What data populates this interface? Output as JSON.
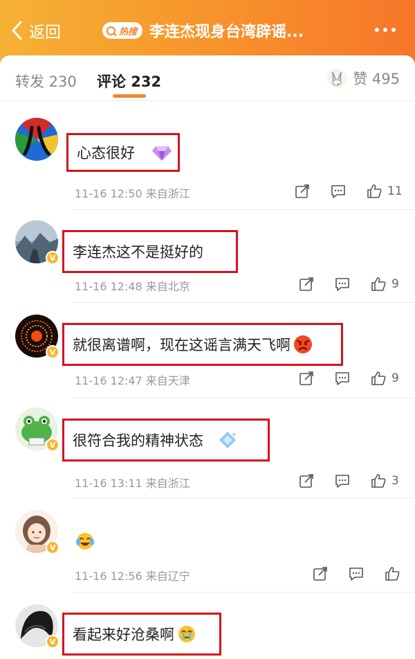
{
  "header": {
    "back_label": "返回",
    "hot_label": "热搜",
    "title": "李连杰现身台湾辟谣..."
  },
  "tabs": {
    "repost": "转发 230",
    "comment": "评论 232",
    "like_label": "赞 495"
  },
  "colors": {
    "accent": "#f7852a",
    "highlight_box": "#d4121c"
  },
  "comments": [
    {
      "avatar_icon": "red-blue-ba-avatar",
      "text": "心态很好",
      "emoji": "purple-diamond-icon",
      "time": "11-16 12:50",
      "location": "来自浙江",
      "likes": "11",
      "verified": false
    },
    {
      "avatar_icon": "seaside-photo-avatar",
      "text": "李连杰这不是挺好的",
      "time": "11-16 12:48",
      "location": "来自北京",
      "likes": "9",
      "verified": true
    },
    {
      "avatar_icon": "fireworks-avatar",
      "text": "就很离谱啊，现在这谣言满天飞啊",
      "emoji": "angry-face-icon",
      "time": "11-16 12:47",
      "location": "来自天津",
      "likes": "9",
      "verified": true
    },
    {
      "avatar_icon": "green-frog-avatar",
      "text": "很符合我的精神状态",
      "emoji": "blue-diamond-icon",
      "time": "11-16 13:11",
      "location": "来自浙江",
      "likes": "3",
      "verified": true
    },
    {
      "avatar_icon": "cartoon-girl-avatar",
      "text": "",
      "emoji": "laughing-crying-icon",
      "time": "11-16 12:56",
      "location": "来自辽宁",
      "likes": "",
      "verified": true
    },
    {
      "avatar_icon": "dark-hair-avatar",
      "text": "看起来好沧桑啊",
      "emoji": "crying-face-icon",
      "verified": true
    }
  ]
}
